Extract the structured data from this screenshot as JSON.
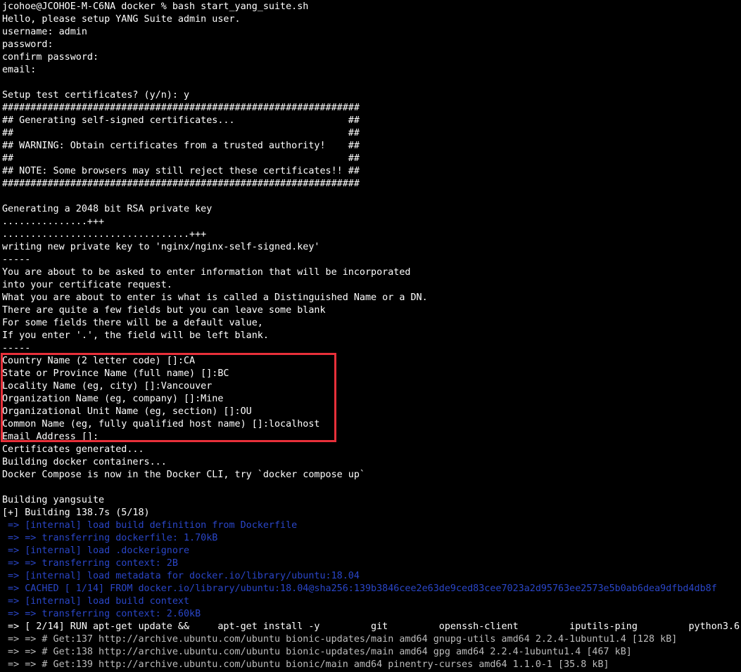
{
  "colors": {
    "background": "#000000",
    "text": "#ffffff",
    "build_step": "#2a46c8",
    "build_log": "#bcbcbc",
    "highlight": "#e8303a"
  },
  "terminal": {
    "lines": [
      {
        "text": "jcohoe@JCOHOE-M-C6NA docker % bash start_yang_suite.sh",
        "style": "white"
      },
      {
        "text": "Hello, please setup YANG Suite admin user.",
        "style": "white"
      },
      {
        "text": "username: admin",
        "style": "white"
      },
      {
        "text": "password:",
        "style": "white"
      },
      {
        "text": "confirm password:",
        "style": "white"
      },
      {
        "text": "email:",
        "style": "white"
      },
      {
        "text": "",
        "style": "white"
      },
      {
        "text": "Setup test certificates? (y/n): y",
        "style": "white"
      },
      {
        "text": "###############################################################",
        "style": "white"
      },
      {
        "text": "## Generating self-signed certificates...                    ##",
        "style": "white"
      },
      {
        "text": "##                                                           ##",
        "style": "white"
      },
      {
        "text": "## WARNING: Obtain certificates from a trusted authority!    ##",
        "style": "white"
      },
      {
        "text": "##                                                           ##",
        "style": "white"
      },
      {
        "text": "## NOTE: Some browsers may still reject these certificates!! ##",
        "style": "white"
      },
      {
        "text": "###############################################################",
        "style": "white"
      },
      {
        "text": "",
        "style": "white"
      },
      {
        "text": "Generating a 2048 bit RSA private key",
        "style": "white"
      },
      {
        "text": "...............+++",
        "style": "white"
      },
      {
        "text": ".................................+++",
        "style": "white"
      },
      {
        "text": "writing new private key to 'nginx/nginx-self-signed.key'",
        "style": "white"
      },
      {
        "text": "-----",
        "style": "white"
      },
      {
        "text": "You are about to be asked to enter information that will be incorporated",
        "style": "white"
      },
      {
        "text": "into your certificate request.",
        "style": "white"
      },
      {
        "text": "What you are about to enter is what is called a Distinguished Name or a DN.",
        "style": "white"
      },
      {
        "text": "There are quite a few fields but you can leave some blank",
        "style": "white"
      },
      {
        "text": "For some fields there will be a default value,",
        "style": "white"
      },
      {
        "text": "If you enter '.', the field will be left blank.",
        "style": "white"
      },
      {
        "text": "-----",
        "style": "white"
      },
      {
        "text": "Country Name (2 letter code) []:CA",
        "style": "white"
      },
      {
        "text": "State or Province Name (full name) []:BC",
        "style": "white"
      },
      {
        "text": "Locality Name (eg, city) []:Vancouver",
        "style": "white"
      },
      {
        "text": "Organization Name (eg, company) []:Mine",
        "style": "white"
      },
      {
        "text": "Organizational Unit Name (eg, section) []:OU",
        "style": "white"
      },
      {
        "text": "Common Name (eg, fully qualified host name) []:localhost",
        "style": "white"
      },
      {
        "text": "Email Address []:",
        "style": "white"
      },
      {
        "text": "Certificates generated...",
        "style": "white"
      },
      {
        "text": "Building docker containers...",
        "style": "white"
      },
      {
        "text": "Docker Compose is now in the Docker CLI, try `docker compose up`",
        "style": "white"
      },
      {
        "text": "",
        "style": "white"
      },
      {
        "text": "Building yangsuite",
        "style": "white"
      },
      {
        "text": "[+] Building 138.7s (5/18)",
        "style": "white"
      },
      {
        "text": " => [internal] load build definition from Dockerfile",
        "style": "blue"
      },
      {
        "text": " => => transferring dockerfile: 1.70kB",
        "style": "blue"
      },
      {
        "text": " => [internal] load .dockerignore",
        "style": "blue"
      },
      {
        "text": " => => transferring context: 2B",
        "style": "blue"
      },
      {
        "text": " => [internal] load metadata for docker.io/library/ubuntu:18.04",
        "style": "blue"
      },
      {
        "text": " => CACHED [ 1/14] FROM docker.io/library/ubuntu:18.04@sha256:139b3846cee2e63de9ced83cee7023a2d95763ee2573e5b0ab6dea9dfbd4db8f",
        "style": "blue"
      },
      {
        "text": " => [internal] load build context",
        "style": "blue"
      },
      {
        "text": " => => transferring context: 2.60kB",
        "style": "blue"
      },
      {
        "text": " => [ 2/14] RUN apt-get update &&     apt-get install -y         git         openssh-client         iputils-ping         python3.6",
        "style": "bright"
      },
      {
        "text": " => => # Get:137 http://archive.ubuntu.com/ubuntu bionic-updates/main amd64 gnupg-utils amd64 2.2.4-1ubuntu1.4 [128 kB]",
        "style": "gray"
      },
      {
        "text": " => => # Get:138 http://archive.ubuntu.com/ubuntu bionic-updates/main amd64 gpg amd64 2.2.4-1ubuntu1.4 [467 kB]",
        "style": "gray"
      },
      {
        "text": " => => # Get:139 http://archive.ubuntu.com/ubuntu bionic/main amd64 pinentry-curses amd64 1.1.0-1 [35.8 kB]",
        "style": "gray"
      }
    ]
  }
}
